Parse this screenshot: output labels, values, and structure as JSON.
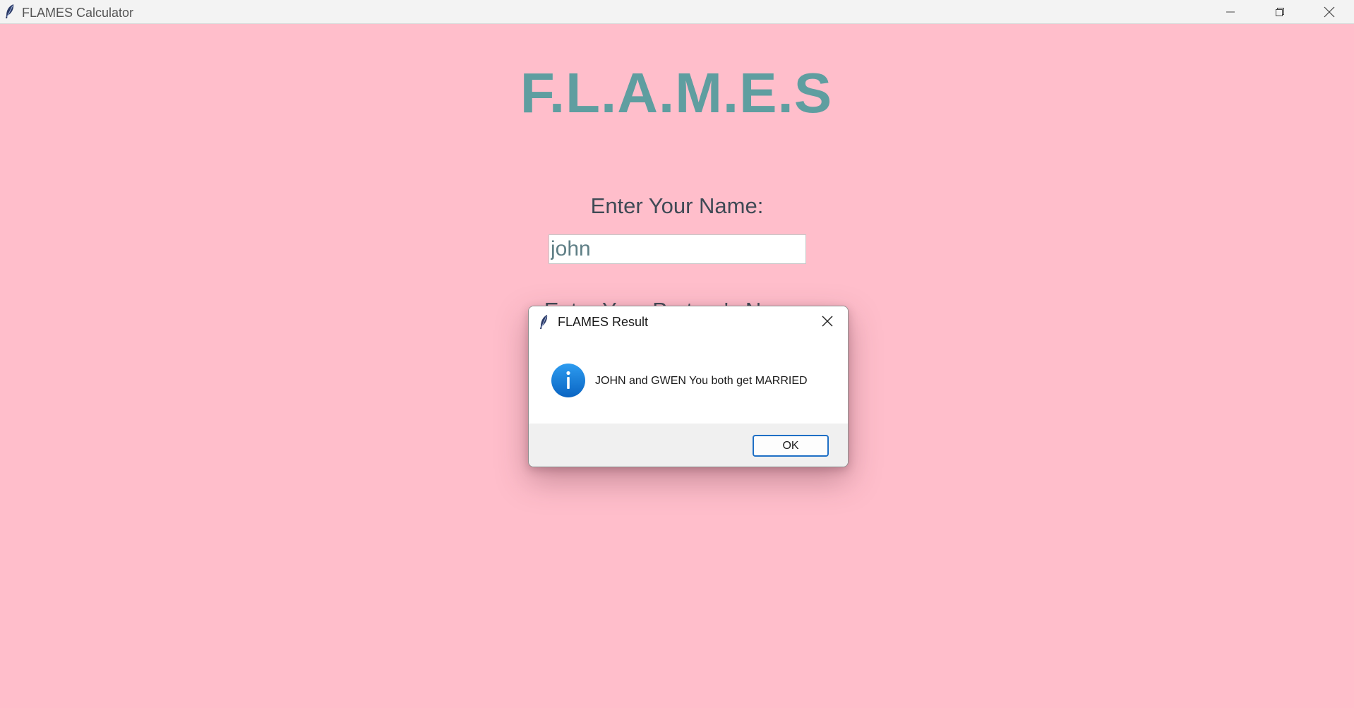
{
  "window": {
    "title": "FLAMES Calculator",
    "background_color": "#ffbecb",
    "controls": {
      "minimize_icon": "minimize-icon",
      "maximize_icon": "restore-icon",
      "close_icon": "close-icon"
    }
  },
  "main": {
    "heading": "F.L.A.M.E.S",
    "heading_color": "#5f9ea0",
    "name_label": "Enter Your Name:",
    "name_value": "john",
    "partner_label": "Enter Your Partner's Name:"
  },
  "dialog": {
    "title": "FLAMES Result",
    "icon": "info-icon",
    "message": "JOHN and GWEN You both get MARRIED",
    "ok_label": "OK",
    "accent_color": "#1f6fc5"
  }
}
